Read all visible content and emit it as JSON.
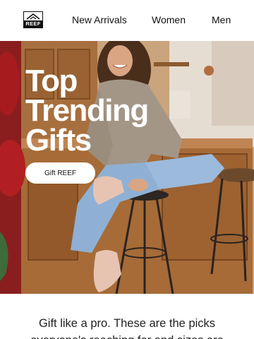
{
  "brand": {
    "logo_text": "REEF"
  },
  "nav": {
    "items": [
      {
        "label": "New Arrivals"
      },
      {
        "label": "Women"
      },
      {
        "label": "Men"
      }
    ]
  },
  "hero": {
    "title_lines": [
      "Top",
      "Trending",
      "Gifts"
    ],
    "cta_label": "Gift REEF"
  },
  "body": {
    "text_line_1": "Gift like a pro. These are the picks",
    "text_line_2": "everyone's reaching for and sizes are"
  },
  "colors": {
    "background": "#ffffff",
    "text": "#111111",
    "cta_background": "#ffffff",
    "hero_title": "#ffffff"
  }
}
